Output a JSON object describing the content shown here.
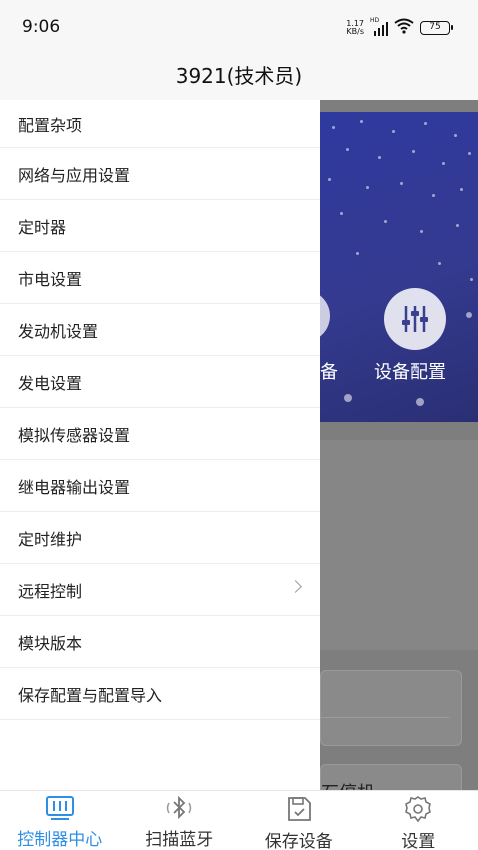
{
  "status_bar": {
    "time": "9:06",
    "net_speed_value": "1.17",
    "net_speed_unit": "KB/s",
    "hd_badge": "HD",
    "battery": "75"
  },
  "header": {
    "title": "3921(技术员)"
  },
  "drawer": {
    "items": [
      {
        "label": "配置杂项"
      },
      {
        "label": "网络与应用设置"
      },
      {
        "label": "定时器"
      },
      {
        "label": "市电设置"
      },
      {
        "label": "发动机设置"
      },
      {
        "label": "发电设置"
      },
      {
        "label": "模拟传感器设置"
      },
      {
        "label": "继电器输出设置"
      },
      {
        "label": "定时维护"
      },
      {
        "label": "远程控制",
        "has_submenu": true
      },
      {
        "label": "模块版本"
      },
      {
        "label": "保存配置与配置导入"
      }
    ]
  },
  "background": {
    "partial_label": "备",
    "device_config_label": "设备配置",
    "card_partial_text": "石停机"
  },
  "bottom_nav": {
    "items": [
      {
        "label": "控制器中心",
        "icon": "controller-icon",
        "active": true
      },
      {
        "label": "扫描蓝牙",
        "icon": "bluetooth-icon",
        "active": false
      },
      {
        "label": "保存设备",
        "icon": "save-device-icon",
        "active": false
      },
      {
        "label": "设置",
        "icon": "gear-icon",
        "active": false
      }
    ]
  },
  "colors": {
    "accent": "#2f8fe6",
    "banner": "#343a8f",
    "overlay": "#7e7e7e"
  }
}
